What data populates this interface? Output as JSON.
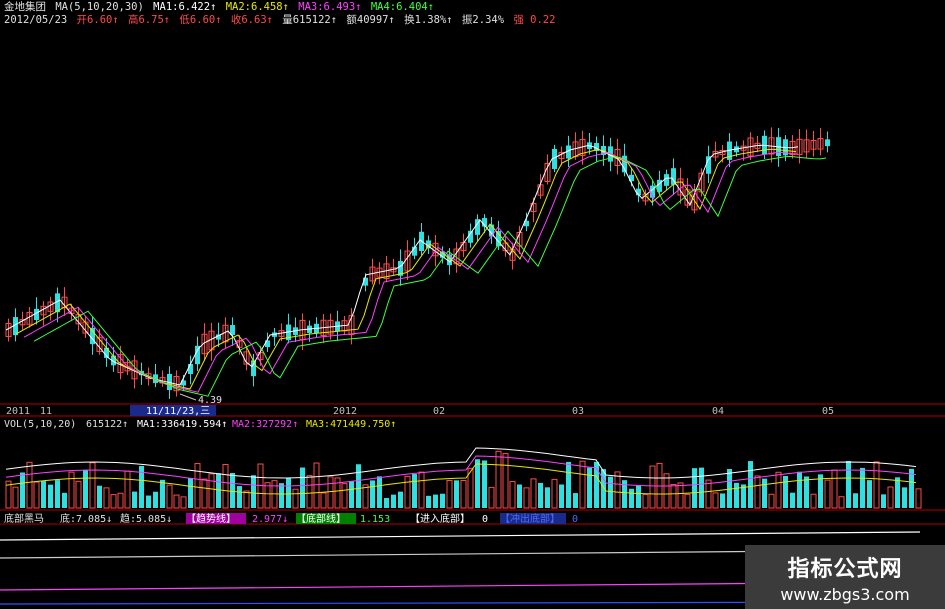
{
  "header": {
    "stock_name": "金地集团",
    "ma_label": "MA(5,10,20,30)",
    "ma1": "MA1:6.422↑",
    "ma2": "MA2:6.458↑",
    "ma3": "MA3:6.493↑",
    "ma4": "MA4:6.404↑",
    "date": "2012/05/23",
    "open": "开6.60↑",
    "high": "高6.75↑",
    "low": "低6.60↑",
    "close": "收6.63↑",
    "volume": "量615122↑",
    "amount": "额40997↑",
    "turnover": "换1.38%↑",
    "amplitude": "振2.34%",
    "strength": "强 0.22"
  },
  "price_panel": {
    "low_label": "4.39",
    "x_axis_labels": [
      "2011",
      "11",
      "11/11/23,三",
      "2012",
      "02",
      "03",
      "04",
      "05"
    ]
  },
  "volume_panel": {
    "label": "VOL(5,10,20)",
    "value": "615122↑",
    "ma1": "MA1:336419.594↑",
    "ma2": "MA2:327292↑",
    "ma3": "MA3:471449.750↑"
  },
  "indicator_panel": {
    "name": "底部黑马",
    "di": "底:7.085↓",
    "qu": "趋:5.085↓",
    "trend_line_tag": "【趋势线】",
    "trend_line_value": "2.977↓",
    "bottom_line_tag": "【底部线】",
    "bottom_line_value": "1.153",
    "enter_bottom_tag": "【进入底部】",
    "enter_bottom_value": "0",
    "breakout_tag": "【冲出底部】",
    "breakout_value": "0"
  },
  "watermark": {
    "title": "指标公式网",
    "url": "www.zbgs3.com"
  },
  "colors": {
    "up": "#ff4a4a",
    "down": "#2ee0e0",
    "axis": "#b00000",
    "ma1": "#ffffff",
    "ma2": "#e8e800",
    "ma3": "#ff40ff",
    "ma4": "#40ff40",
    "label_bg": "#1a2a8a"
  },
  "chart_data": {
    "type": "candlestick",
    "x_axis_labels": [
      "2011",
      "11",
      "2012",
      "02",
      "03",
      "04",
      "05"
    ],
    "annotated_low": 4.39,
    "last_bar": {
      "open": 6.6,
      "high": 6.75,
      "low": 6.6,
      "close": 6.63,
      "volume": 615122
    },
    "moving_averages": {
      "MA1": 6.422,
      "MA2": 6.458,
      "MA3": 6.493,
      "MA4": 6.404
    },
    "volume_moving_averages": {
      "MA1": 336419.594,
      "MA2": 327292,
      "MA3": 471449.75
    },
    "indicator": {
      "底": 7.085,
      "趋": 5.085,
      "趋势线": 2.977,
      "底部线": 1.153,
      "进入底部": 0,
      "冲出底部": 0
    }
  }
}
